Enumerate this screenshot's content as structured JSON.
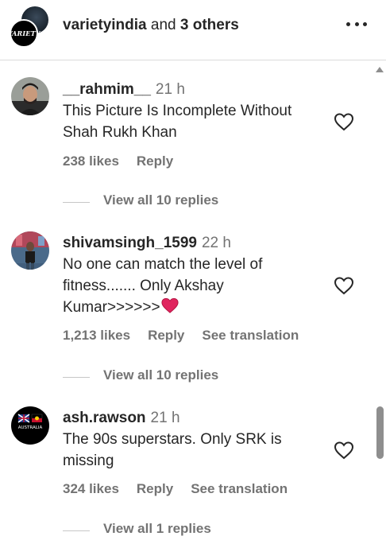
{
  "header": {
    "title_user": "varietyindia",
    "title_rest": " and ",
    "title_others": "3 others",
    "logo_text": "VARIETY",
    "more_icon": "more-horizontal-icon"
  },
  "comments": [
    {
      "username": "__rahmim__",
      "time": "21 h",
      "text_lines": [
        "This Picture Is Incomplete Without",
        "Shah Rukh Khan"
      ],
      "likes": "238 likes",
      "reply": "Reply",
      "replies": "View all 10 replies"
    },
    {
      "username": "shivamsingh_1599",
      "time": "22 h",
      "text_lines": [
        "No one can match the level of",
        "fitness....... Only Akshay",
        "Kumar>>>>>>"
      ],
      "likes": "1,213 likes",
      "reply": "Reply",
      "see_translation": "See translation",
      "replies": "View all 10 replies"
    },
    {
      "username": "ash.rawson",
      "time": "21 h",
      "avatar_text": "AUSTRALIA",
      "text_lines": [
        "The 90s superstars. Only SRK is",
        "missing"
      ],
      "likes": "324 likes",
      "reply": "Reply",
      "see_translation": "See translation",
      "replies_partial": "View all 1 replies"
    }
  ],
  "colors": {
    "text": "#262626",
    "secondary": "#737373",
    "divider": "#dbdbdb",
    "heart_emoji": "#e0245e"
  }
}
